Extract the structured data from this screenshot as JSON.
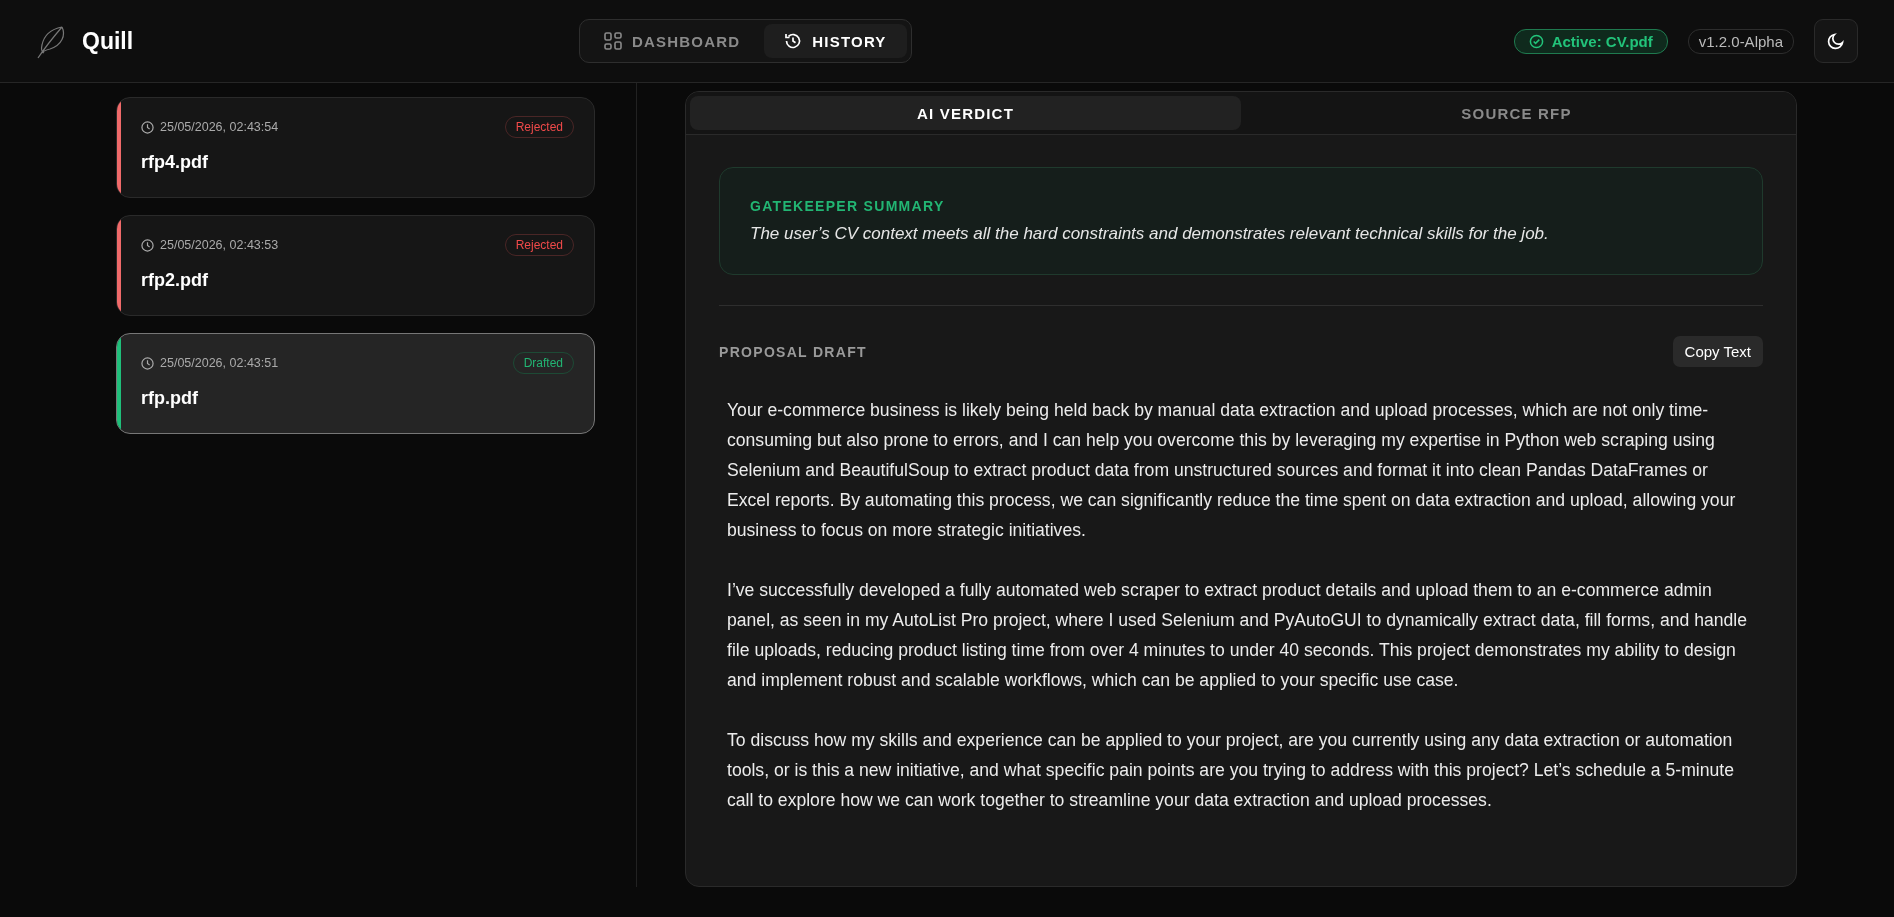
{
  "app": {
    "name": "Quill"
  },
  "nav": [
    {
      "label": "DASHBOARD",
      "kind": "grid",
      "selected": false
    },
    {
      "label": "HISTORY",
      "kind": "history",
      "selected": true
    }
  ],
  "status": {
    "active_file": "Active: CV.pdf",
    "version": "v1.2.0-Alpha"
  },
  "history": [
    {
      "timestamp": "25/05/2026, 02:43:54",
      "filename": "rfp4.pdf",
      "status": "Rejected",
      "kind": "rejected",
      "selected": false
    },
    {
      "timestamp": "25/05/2026, 02:43:53",
      "filename": "rfp2.pdf",
      "status": "Rejected",
      "kind": "rejected",
      "selected": false
    },
    {
      "timestamp": "25/05/2026, 02:43:51",
      "filename": "rfp.pdf",
      "status": "Drafted",
      "kind": "drafted",
      "selected": true
    }
  ],
  "tabs": [
    {
      "label": "AI VERDICT",
      "selected": true
    },
    {
      "label": "SOURCE RFP",
      "selected": false
    }
  ],
  "summary": {
    "title": "GATEKEEPER SUMMARY",
    "text": "The user’s CV context meets all the hard constraints and demonstrates relevant technical skills for the job."
  },
  "proposal": {
    "title": "PROPOSAL DRAFT",
    "copy_button": "Copy Text",
    "paragraphs": [
      "Your e-commerce business is likely being held back by manual data extraction and upload processes, which are not only time-consuming but also prone to errors, and I can help you overcome this by leveraging my expertise in Python web scraping using Selenium and BeautifulSoup to extract product data from unstructured sources and format it into clean Pandas DataFrames or Excel reports. By automating this process, we can significantly reduce the time spent on data extraction and upload, allowing your business to focus on more strategic initiatives.",
      "I’ve successfully developed a fully automated web scraper to extract product details and upload them to an e-commerce admin panel, as seen in my AutoList Pro project, where I used Selenium and PyAutoGUI to dynamically extract data, fill forms, and handle file uploads, reducing product listing time from over 4 minutes to under 40 seconds. This project demonstrates my ability to design and implement robust and scalable workflows, which can be applied to your specific use case.",
      "To discuss how my skills and experience can be applied to your project, are you currently using any data extraction or automation tools, or is this a new initiative, and what specific pain points are you trying to address with this project? Let’s schedule a 5-minute call to explore how we can work together to streamline your data extraction and upload processes."
    ]
  }
}
